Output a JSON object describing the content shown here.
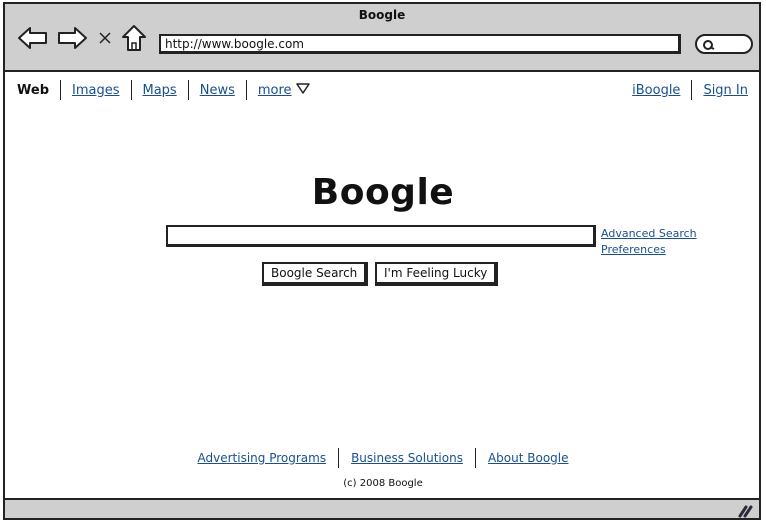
{
  "window": {
    "title": "Boogle"
  },
  "browser": {
    "url": "http://www.boogle.com",
    "icons": [
      "back-arrow-icon",
      "forward-arrow-icon",
      "stop-icon",
      "home-icon",
      "search-icon"
    ]
  },
  "topnav": {
    "items": [
      {
        "label": "Web",
        "current": true
      },
      {
        "label": "Images"
      },
      {
        "label": "Maps"
      },
      {
        "label": "News"
      },
      {
        "label": "more"
      }
    ]
  },
  "rightnav": {
    "items": [
      {
        "label": "iBoogle"
      },
      {
        "label": "Sign In"
      }
    ]
  },
  "main": {
    "logo": "Boogle",
    "search_value": "",
    "side_links": [
      "Advanced Search",
      "Preferences"
    ],
    "buttons": {
      "search": "Boogle Search",
      "lucky": "I'm Feeling Lucky"
    }
  },
  "footer": {
    "links": [
      "Advertising Programs",
      "Business Solutions",
      "About Boogle"
    ],
    "copyright": "(c) 2008 Boogle"
  },
  "colors": {
    "link": "#1a4f8e",
    "chrome": "#cfcfcf",
    "stroke": "#222222"
  }
}
